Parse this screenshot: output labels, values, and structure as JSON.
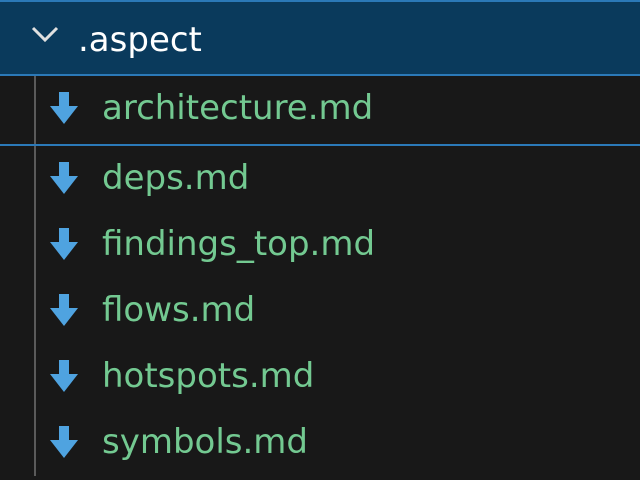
{
  "folder": {
    "name": ".aspect",
    "expand_icon": "chevron-down-icon"
  },
  "files": [
    {
      "name": "architecture.md",
      "icon": "markdown-arrow-down-icon"
    },
    {
      "name": "deps.md",
      "icon": "markdown-arrow-down-icon"
    },
    {
      "name": "findings_top.md",
      "icon": "markdown-arrow-down-icon"
    },
    {
      "name": "flows.md",
      "icon": "markdown-arrow-down-icon"
    },
    {
      "name": "hotspots.md",
      "icon": "markdown-arrow-down-icon"
    },
    {
      "name": "symbols.md",
      "icon": "markdown-arrow-down-icon"
    }
  ],
  "colors": {
    "background": "#181818",
    "folder_row_bg": "#0a3a5c",
    "focus_border": "#2b79b8",
    "file_text": "#73c991",
    "icon": "#4fa3e0",
    "folder_text": "#ffffff"
  }
}
